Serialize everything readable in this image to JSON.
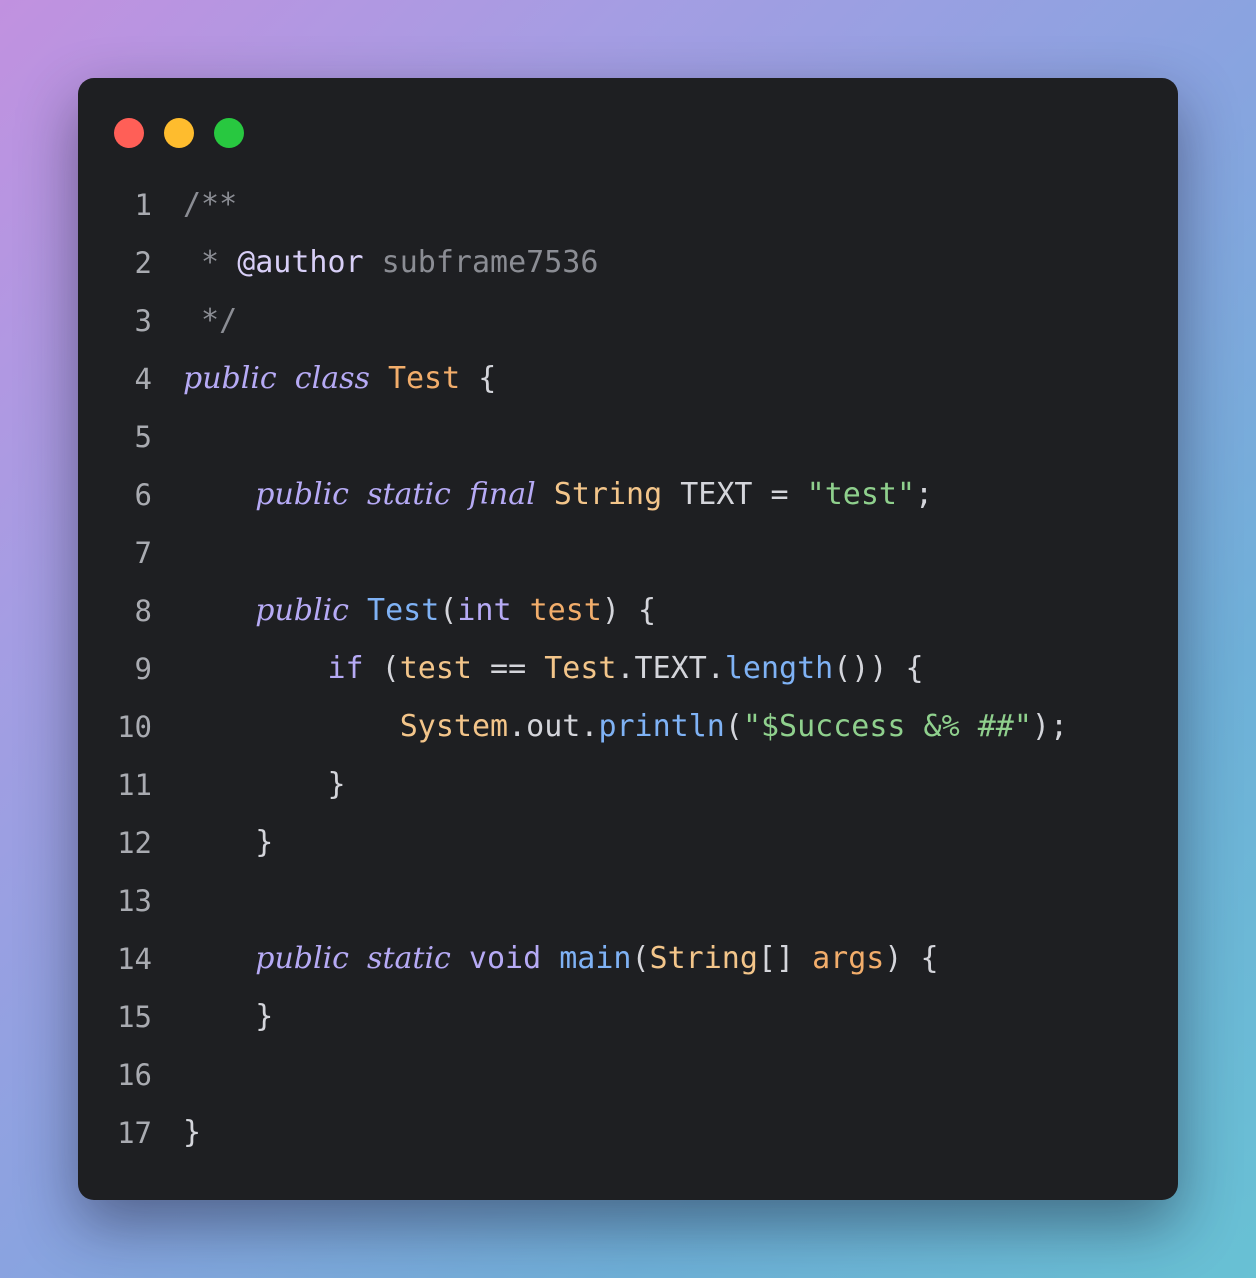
{
  "window": {
    "colors": {
      "background": "#1e1f22",
      "close": "#ff5f57",
      "minimize": "#febc2e",
      "maximize": "#28c840"
    }
  },
  "code": {
    "lines": [
      {
        "number": "1",
        "tokens": [
          {
            "text": "/**",
            "kind": "comment"
          }
        ]
      },
      {
        "number": "2",
        "tokens": [
          {
            "text": " * ",
            "kind": "comment"
          },
          {
            "text": "@author",
            "kind": "tag"
          },
          {
            "text": " subframe7536",
            "kind": "comment"
          }
        ]
      },
      {
        "number": "3",
        "tokens": [
          {
            "text": " */",
            "kind": "comment"
          }
        ]
      },
      {
        "number": "4",
        "tokens": [
          {
            "text": "public",
            "kind": "kw-italic"
          },
          {
            "text": " ",
            "kind": "plain"
          },
          {
            "text": "class",
            "kind": "kw-italic"
          },
          {
            "text": " ",
            "kind": "plain"
          },
          {
            "text": "Test",
            "kind": "param"
          },
          {
            "text": " {",
            "kind": "plain"
          }
        ]
      },
      {
        "number": "5",
        "tokens": []
      },
      {
        "number": "6",
        "tokens": [
          {
            "text": "    ",
            "kind": "plain"
          },
          {
            "text": "public",
            "kind": "kw-italic"
          },
          {
            "text": " ",
            "kind": "plain"
          },
          {
            "text": "static",
            "kind": "kw-italic"
          },
          {
            "text": " ",
            "kind": "plain"
          },
          {
            "text": "final",
            "kind": "kw-italic"
          },
          {
            "text": " ",
            "kind": "plain"
          },
          {
            "text": "String",
            "kind": "type"
          },
          {
            "text": " TEXT = ",
            "kind": "plain"
          },
          {
            "text": "\"test\"",
            "kind": "string"
          },
          {
            "text": ";",
            "kind": "plain"
          }
        ]
      },
      {
        "number": "7",
        "tokens": []
      },
      {
        "number": "8",
        "tokens": [
          {
            "text": "    ",
            "kind": "plain"
          },
          {
            "text": "public",
            "kind": "kw-italic"
          },
          {
            "text": " ",
            "kind": "plain"
          },
          {
            "text": "Test",
            "kind": "fn"
          },
          {
            "text": "(",
            "kind": "plain"
          },
          {
            "text": "int",
            "kind": "kw"
          },
          {
            "text": " ",
            "kind": "plain"
          },
          {
            "text": "test",
            "kind": "param"
          },
          {
            "text": ") {",
            "kind": "plain"
          }
        ]
      },
      {
        "number": "9",
        "tokens": [
          {
            "text": "        ",
            "kind": "plain"
          },
          {
            "text": "if",
            "kind": "kw"
          },
          {
            "text": " (",
            "kind": "plain"
          },
          {
            "text": "test",
            "kind": "type"
          },
          {
            "text": " == ",
            "kind": "plain"
          },
          {
            "text": "Test",
            "kind": "type"
          },
          {
            "text": ".TEXT.",
            "kind": "plain"
          },
          {
            "text": "length",
            "kind": "fn"
          },
          {
            "text": "()) {",
            "kind": "plain"
          }
        ]
      },
      {
        "number": "10",
        "tokens": [
          {
            "text": "            ",
            "kind": "plain"
          },
          {
            "text": "System",
            "kind": "type"
          },
          {
            "text": ".out.",
            "kind": "plain"
          },
          {
            "text": "println",
            "kind": "fn"
          },
          {
            "text": "(",
            "kind": "plain"
          },
          {
            "text": "\"$Success &% ##\"",
            "kind": "string"
          },
          {
            "text": ");",
            "kind": "plain"
          }
        ]
      },
      {
        "number": "11",
        "tokens": [
          {
            "text": "        }",
            "kind": "plain"
          }
        ]
      },
      {
        "number": "12",
        "tokens": [
          {
            "text": "    }",
            "kind": "plain"
          }
        ]
      },
      {
        "number": "13",
        "tokens": []
      },
      {
        "number": "14",
        "tokens": [
          {
            "text": "    ",
            "kind": "plain"
          },
          {
            "text": "public",
            "kind": "kw-italic"
          },
          {
            "text": " ",
            "kind": "plain"
          },
          {
            "text": "static",
            "kind": "kw-italic"
          },
          {
            "text": " ",
            "kind": "plain"
          },
          {
            "text": "void",
            "kind": "kw"
          },
          {
            "text": " ",
            "kind": "plain"
          },
          {
            "text": "main",
            "kind": "fn"
          },
          {
            "text": "(",
            "kind": "plain"
          },
          {
            "text": "String",
            "kind": "type"
          },
          {
            "text": "[] ",
            "kind": "plain"
          },
          {
            "text": "args",
            "kind": "param"
          },
          {
            "text": ") {",
            "kind": "plain"
          }
        ]
      },
      {
        "number": "15",
        "tokens": [
          {
            "text": "    }",
            "kind": "plain"
          }
        ]
      },
      {
        "number": "16",
        "tokens": []
      },
      {
        "number": "17",
        "tokens": [
          {
            "text": "}",
            "kind": "plain"
          }
        ]
      }
    ]
  }
}
